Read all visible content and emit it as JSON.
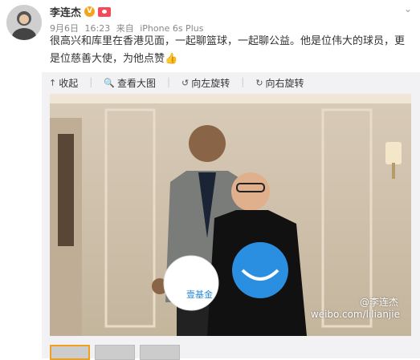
{
  "post": {
    "author": "李连杰",
    "verified_badge": "V",
    "date": "9月6日",
    "time": "16:23",
    "source_prefix": "来自",
    "source": "iPhone 6s Plus",
    "text": "很高兴和库里在香港见面，一起聊篮球，一起聊公益。他是位伟大的球员，更是位慈善大使，为他点赞",
    "emoji": "👍"
  },
  "toolbar": {
    "collect": "收起",
    "view_large": "查看大图",
    "rotate_left": "向左旋转",
    "rotate_right": "向右旋转"
  },
  "image": {
    "watermark_handle": "@李连杰",
    "watermark_url": "weibo.com/lilianjie",
    "sign_left_text": "壹基金"
  },
  "thumbnails": [
    {
      "label": "thumb-1",
      "active": true
    },
    {
      "label": "thumb-2",
      "active": false
    },
    {
      "label": "thumb-3",
      "active": false
    }
  ],
  "colors": {
    "accent": "#f0a020",
    "vip_badge": "#f4a41b",
    "crown": "#f44a59",
    "thumb_emoji": "#f5a623"
  },
  "icons": [
    "avatar",
    "verified-icon",
    "vip-crown-icon",
    "more-icon",
    "collapse-icon",
    "zoom-icon",
    "rotate-left-icon",
    "rotate-right-icon",
    "thumbs-up-emoji"
  ]
}
